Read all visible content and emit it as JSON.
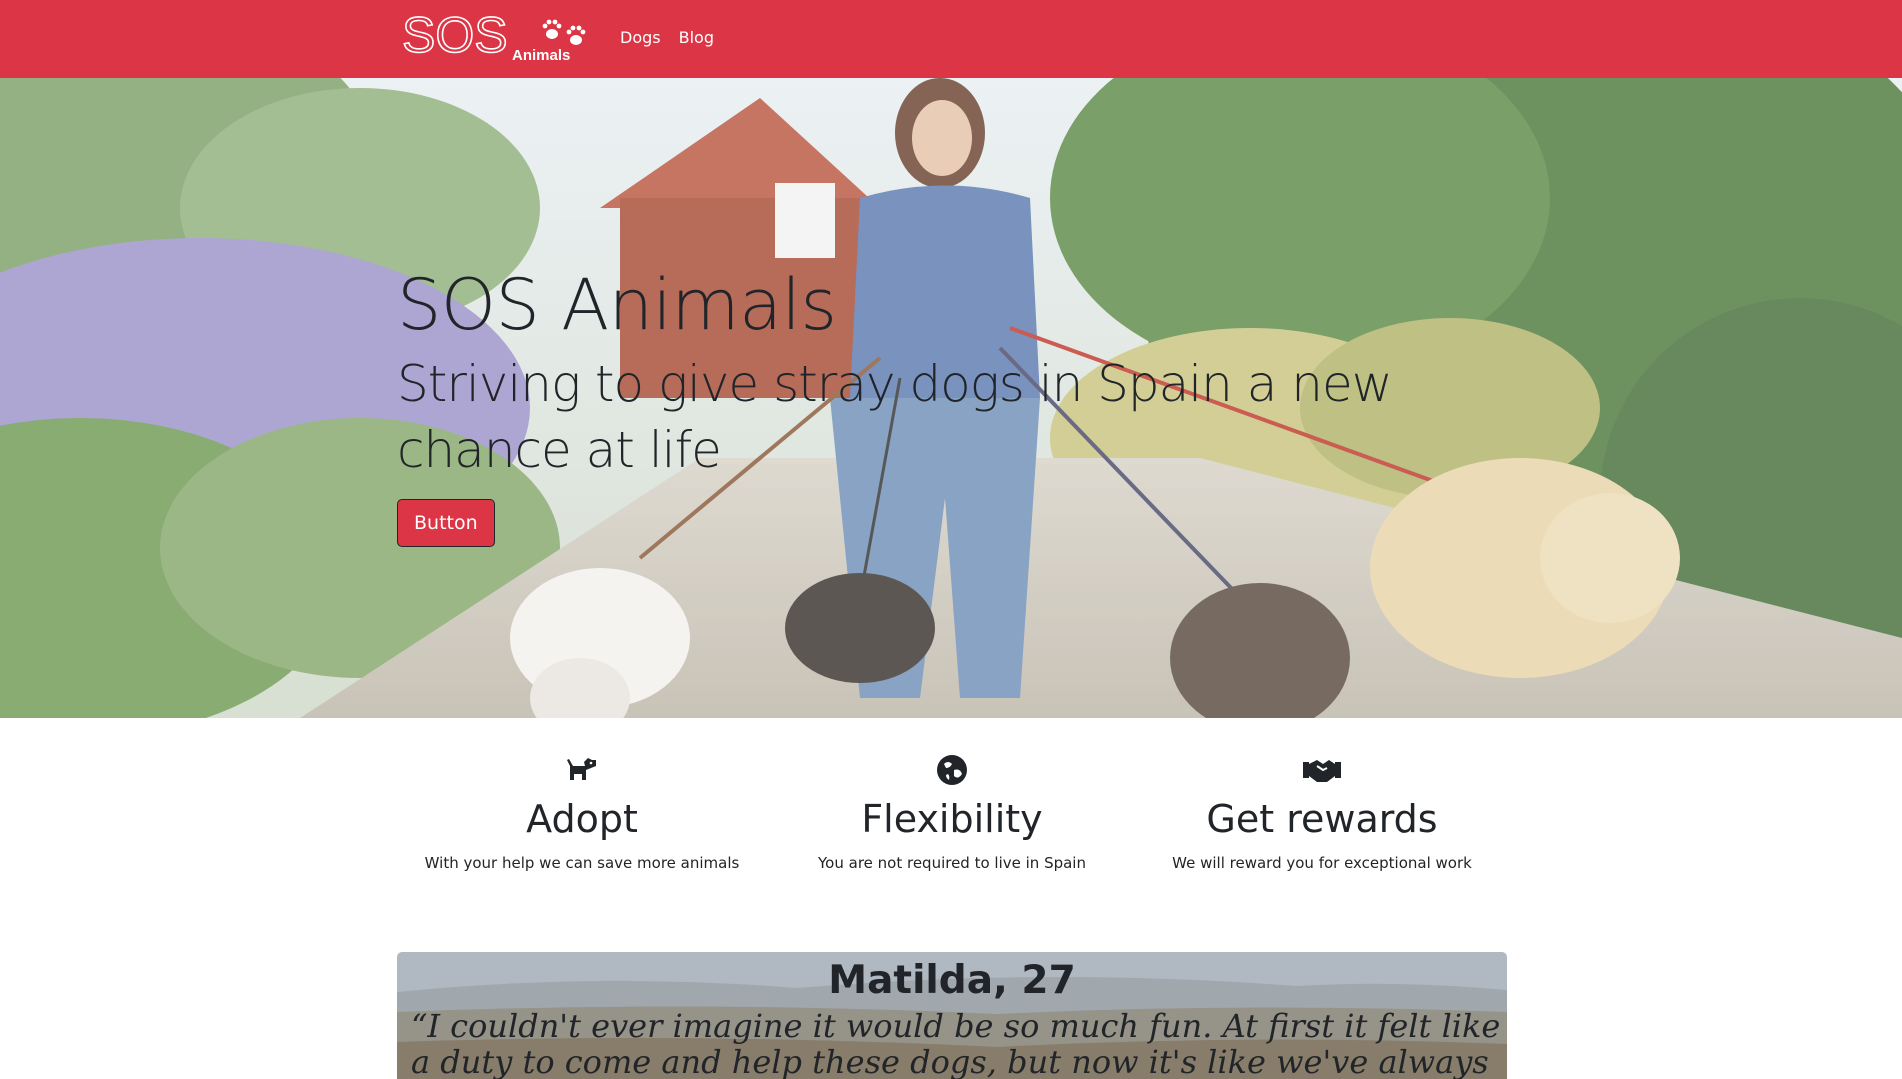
{
  "navbar": {
    "brand": {
      "logo_main": "SOS",
      "logo_sub": "Animals",
      "icon": "paw-prints-icon"
    },
    "links": [
      "Dogs",
      "Blog"
    ],
    "color": "#dc3545"
  },
  "hero": {
    "title": "SOS Animals",
    "subtitle": "Striving to give stray dogs in Spain a new chance at life",
    "button_label": "Button",
    "background": "photo of a woman walking four dogs on leashes in a garden"
  },
  "features": [
    {
      "icon": "dog-icon",
      "title": "Adopt",
      "text": "With your help we can save more animals"
    },
    {
      "icon": "globe-icon",
      "title": "Flexibility",
      "text": "You are not required to live in Spain"
    },
    {
      "icon": "handshake-icon",
      "title": "Get rewards",
      "text": "We will reward you for exceptional work"
    }
  ],
  "testimonial": {
    "name": "Matilda, 27",
    "quote": "“I couldn't ever imagine it would be so much fun. At first it felt like a duty to come and help these dogs, but now it's like we've always been a"
  },
  "colors": {
    "accent": "#dc3545",
    "text": "#212529",
    "white": "#ffffff"
  }
}
